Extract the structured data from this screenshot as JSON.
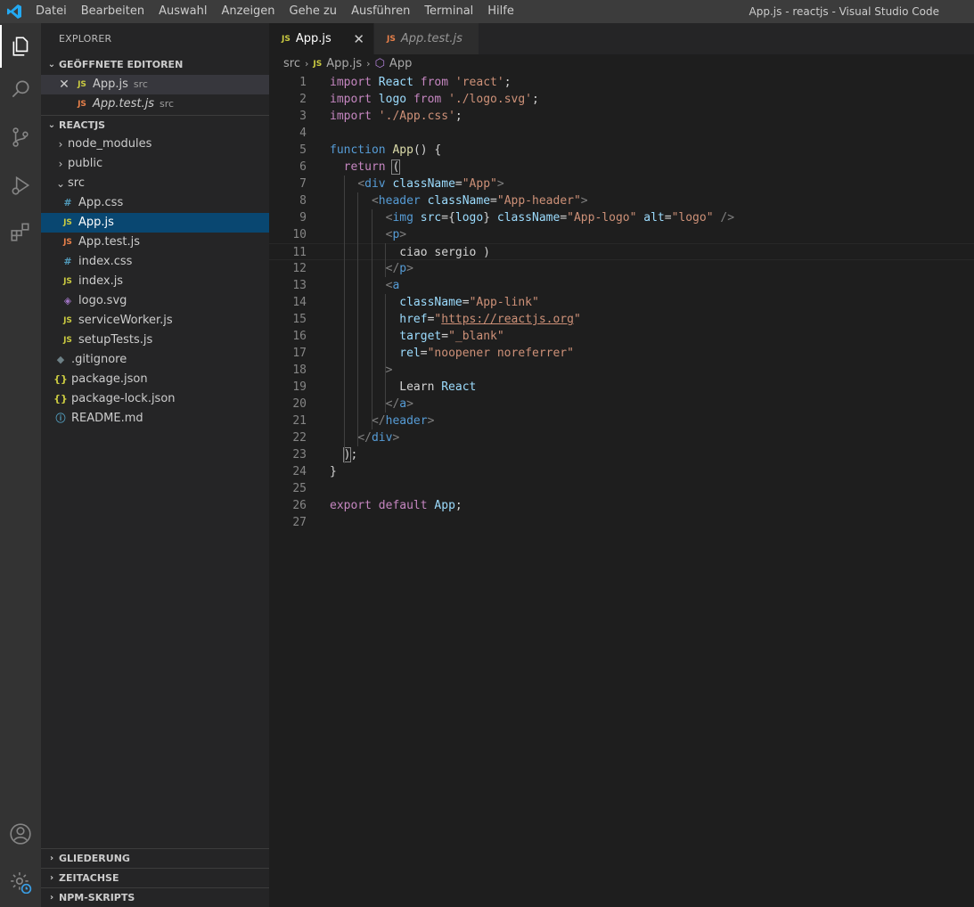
{
  "titlebar": {
    "menu": [
      "Datei",
      "Bearbeiten",
      "Auswahl",
      "Anzeigen",
      "Gehe zu",
      "Ausführen",
      "Terminal",
      "Hilfe"
    ],
    "title": "App.js - reactjs - Visual Studio Code"
  },
  "activitybar": {
    "icons": [
      "explorer-icon",
      "search-icon",
      "source-control-icon",
      "run-debug-icon",
      "extensions-icon",
      "account-icon",
      "manage-gear-icon"
    ]
  },
  "sidebar": {
    "title": "EXPLORER",
    "open_editors": {
      "header": "GEÖFFNETE EDITOREN",
      "items": [
        {
          "name": "App.js",
          "desc": "src"
        },
        {
          "name": "App.test.js",
          "desc": "src"
        }
      ]
    },
    "project": {
      "header": "REACTJS",
      "items": [
        {
          "name": "node_modules"
        },
        {
          "name": "public"
        },
        {
          "name": "src"
        },
        {
          "name": "App.css"
        },
        {
          "name": "App.js"
        },
        {
          "name": "App.test.js"
        },
        {
          "name": "index.css"
        },
        {
          "name": "index.js"
        },
        {
          "name": "logo.svg"
        },
        {
          "name": "serviceWorker.js"
        },
        {
          "name": "setupTests.js"
        },
        {
          "name": ".gitignore"
        },
        {
          "name": "package.json"
        },
        {
          "name": "package-lock.json"
        },
        {
          "name": "README.md"
        }
      ]
    },
    "bottom_sections": [
      "GLIEDERUNG",
      "ZEITACHSE",
      "NPM-SKRIPTS"
    ]
  },
  "editor": {
    "tabs": [
      {
        "label": "App.js",
        "active": true
      },
      {
        "label": "App.test.js",
        "active": false
      }
    ],
    "breadcrumb": {
      "folder": "src",
      "file": "App.js",
      "symbol": "App"
    },
    "line_numbers": [
      "1",
      "2",
      "3",
      "4",
      "5",
      "6",
      "7",
      "8",
      "9",
      "10",
      "11",
      "12",
      "13",
      "14",
      "15",
      "16",
      "17",
      "18",
      "19",
      "20",
      "21",
      "22",
      "23",
      "24",
      "25",
      "26",
      "27"
    ],
    "code": [
      "import React from 'react';",
      "import logo from './logo.svg';",
      "import './App.css';",
      "",
      "function App() {",
      "  return (",
      "    <div className=\"App\">",
      "      <header className=\"App-header\">",
      "        <img src={logo} className=\"App-logo\" alt=\"logo\" />",
      "        <p>",
      "          ciao sergio )",
      "        </p>",
      "        <a",
      "          className=\"App-link\"",
      "          href=\"https://reactjs.org\"",
      "          target=\"_blank\"",
      "          rel=\"noopener noreferrer\"",
      "        >",
      "          Learn React",
      "        </a>",
      "      </header>",
      "    </div>",
      "  );",
      "}",
      "",
      "export default App;",
      ""
    ]
  }
}
